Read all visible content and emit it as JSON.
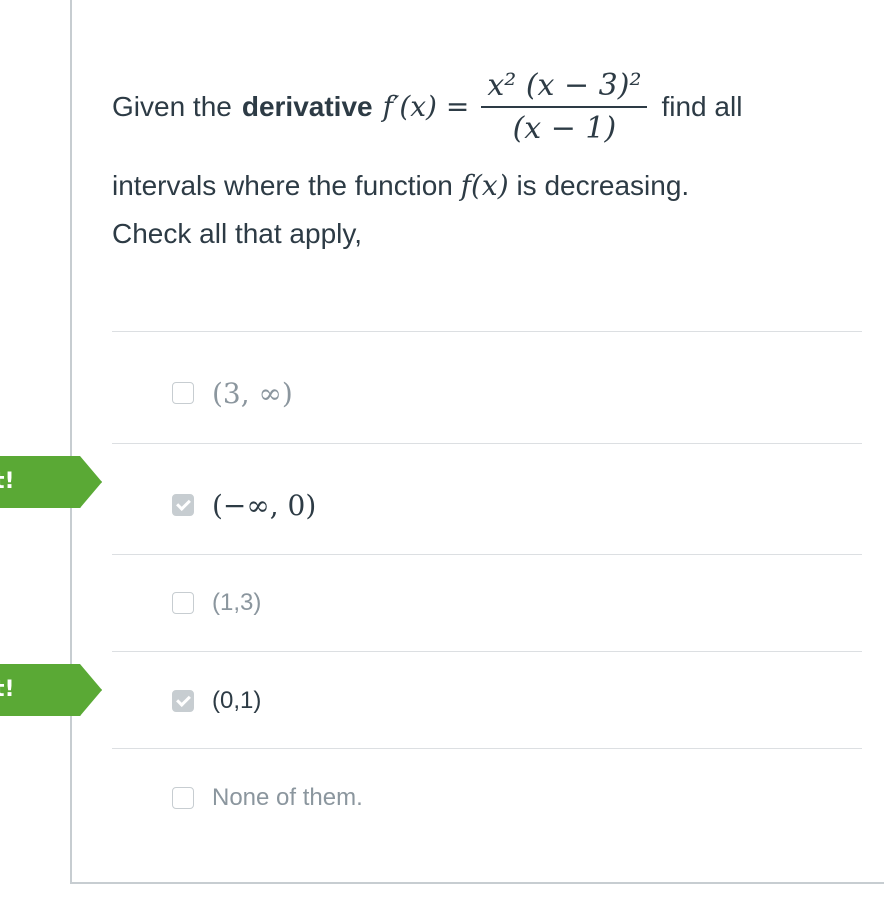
{
  "question": {
    "prefix": "Given the",
    "bold_word": "derivative",
    "function_lhs": "f′(x) =",
    "fraction_numerator": "x² (x − 3)²",
    "fraction_denominator": "(x − 1)",
    "suffix": "find all",
    "line2_prefix": "intervals where the function",
    "line2_math": "f(x)",
    "line2_suffix": "is decreasing.",
    "line3": "Check all that apply,"
  },
  "answers": [
    {
      "label": "(3, ∞)",
      "checked": false
    },
    {
      "label": "(−∞, 0)",
      "checked": true
    },
    {
      "label": "(1,3)",
      "checked": false
    },
    {
      "label": "(0,1)",
      "checked": true
    },
    {
      "label": "None of them.",
      "checked": false
    }
  ],
  "flags": [
    {
      "label": "t!"
    },
    {
      "label": "t!"
    }
  ],
  "colors": {
    "flag_green": "#5aa935",
    "text": "#2d3b45",
    "muted_text": "#8b969e",
    "border": "#c7cdd1"
  }
}
